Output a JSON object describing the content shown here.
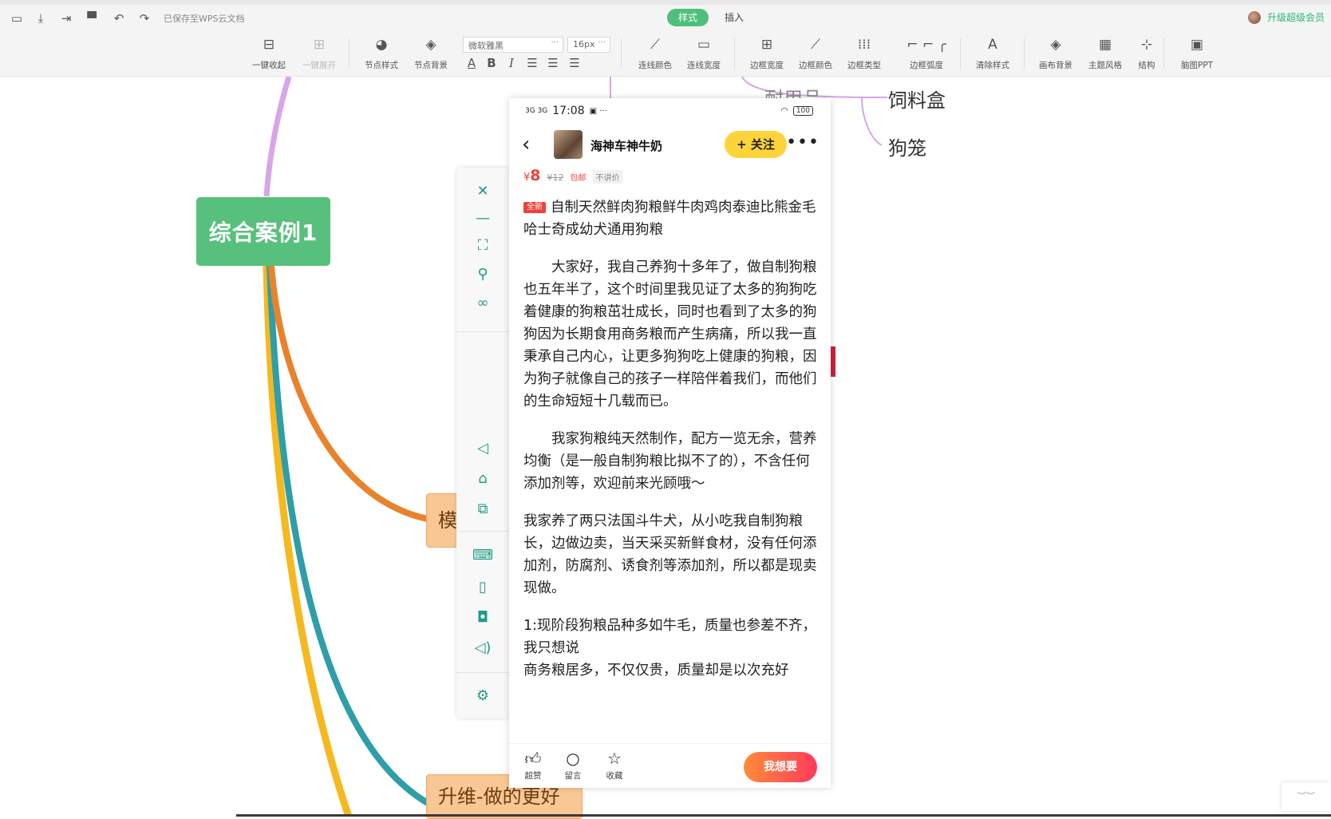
{
  "topbar": {
    "save_status": "已保存至WPS云文档",
    "tabs": [
      {
        "label": "样式",
        "active": true
      },
      {
        "label": "插入",
        "active": false
      }
    ],
    "upgrade_label": "升级超级会员",
    "quick_icons": [
      "window-icon",
      "download-icon",
      "export-icon",
      "format-painter-icon",
      "undo-icon",
      "redo-icon"
    ]
  },
  "toolbar": {
    "collapse_all": "一键收起",
    "expand_all": "一键展开",
    "node_style": "节点样式",
    "node_background": "节点背景",
    "font_family": "微软雅黑",
    "font_size": "16px",
    "format": {
      "font_color": "A",
      "bold": "B",
      "italic": "I"
    },
    "line_color": "连线颜色",
    "line_width": "连线宽度",
    "border_width": "边框宽度",
    "border_color": "边框颜色",
    "border_type": "边框类型",
    "border_radius": "边框弧度",
    "clear_style": "清除样式",
    "canvas_background": "画布背景",
    "theme_style": "主题风格",
    "structure": "结构",
    "mindmap_ppt": "脑图PPT"
  },
  "mindmap": {
    "root": "综合案例1",
    "branch_partial": "模",
    "branch_bottom": "升维-做的更好",
    "leaf_partial_top": "耐用品",
    "leaf_1": "饲料盒",
    "leaf_2": "狗笼",
    "colors": {
      "root": "#57c07c",
      "branch_purple": "#d7a6e8",
      "branch_orange": "#e8832c",
      "branch_yellow": "#f6b81f",
      "branch_teal": "#2e9ea8"
    }
  },
  "sidebar_icons": [
    "close-icon",
    "minimize-icon",
    "fullscreen-icon",
    "pin-icon",
    "link-add-icon",
    "back-icon",
    "home-icon",
    "multi-window-icon",
    "keyboard-icon",
    "rotate-icon",
    "camera-icon",
    "volume-icon",
    "settings-icon"
  ],
  "phone": {
    "status_time": "17:08",
    "status_left": "3G 3G",
    "battery": "100",
    "seller_name": "海神车神牛奶",
    "follow_label": "+ 关注",
    "price_symbol": "¥",
    "price": "8",
    "original_price": "¥12",
    "tag_free_shipping": "包邮",
    "tag_no_bargain": "不讲价",
    "new_badge": "全新",
    "title": "自制天然鲜肉狗粮鲜牛肉鸡肉泰迪比熊金毛哈士奇成幼犬通用狗粮",
    "paragraph_1": "大家好，我自己养狗十多年了，做自制狗粮也五年半了，这个时间里我见证了太多的狗狗吃着健康的狗粮茁壮成长，同时也看到了太多的狗狗因为长期食用商务粮而产生病痛，所以我一直秉承自己内心，让更多狗狗吃上健康的狗粮，因为狗子就像自己的孩子一样陪伴着我们，而他们的生命短短十几载而已。",
    "paragraph_2": "我家狗粮纯天然制作，配方一览无余，营养均衡（是一般自制狗粮比拟不了的），不含任何添加剂等，欢迎前来光顾哦～",
    "paragraph_3": "我家养了两只法国斗牛犬，从小吃我自制狗粮长，边做边卖，当天采买新鲜食材，没有任何添加剂，防腐剂、诱食剂等添加剂，所以都是现卖现做。",
    "paragraph_4a": "1:现阶段狗粮品种多如牛毛，质量也参差不齐，我只想说",
    "paragraph_4b": "商务粮居多，不仅仅贵，质量却是以次充好",
    "bottom": {
      "like": "超赞",
      "comment": "留言",
      "favorite": "收藏",
      "want": "我想要"
    }
  }
}
